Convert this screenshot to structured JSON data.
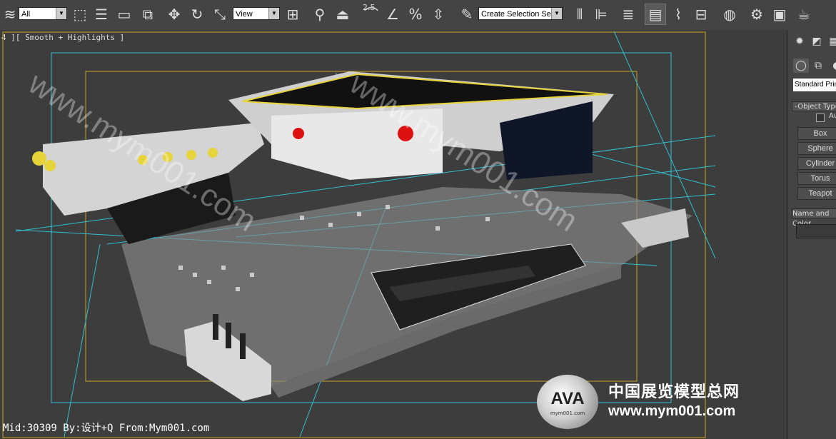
{
  "toolbar": {
    "selection_filter": "All",
    "reference_coord": "View",
    "snap_value": "2.5",
    "named_selection_placeholder": "Create Selection Se",
    "icons": [
      "layers-icon",
      "select-object-icon",
      "select-by-name-icon",
      "rect-region-icon",
      "window-crossing-icon",
      "move-icon",
      "rotate-icon",
      "scale-icon",
      "pivot-icon",
      "link-icon",
      "manipulate-icon",
      "snaps-toggle-icon",
      "angle-snap-icon",
      "percent-snap-icon",
      "spinner-snap-icon",
      "edit-named-sel-icon",
      "mirror-icon",
      "align-icon",
      "layer-manager-icon",
      "graphite-tools-icon",
      "curve-editor-icon",
      "schematic-view-icon",
      "material-editor-icon",
      "render-setup-icon",
      "rendered-frame-icon",
      "render-icon"
    ]
  },
  "viewport": {
    "label": "4 ][ Smooth + Highlights ]",
    "status_text": "Mid:30309 By:设计+Q From:Mym001.com",
    "watermarks": [
      "www.mym001.com",
      "www.mym001.com"
    ],
    "logo": {
      "badge": "AVA",
      "badge_sub": "mym001.com",
      "cn_title": "中国展览模型总网",
      "url": "www.mym001.com"
    },
    "colors": {
      "safe_frame": "#c8a41e",
      "camera": "#30c0d0",
      "background": "#3d3d3d"
    }
  },
  "command_panel": {
    "category_dropdown": "Standard Primitives",
    "object_type_header": "Object Type",
    "autogrid_label": "AutoGrid",
    "primitives": [
      "Box",
      "Sphere",
      "Cylinder",
      "Torus",
      "Teapot"
    ],
    "name_color_header": "Name and Color"
  }
}
